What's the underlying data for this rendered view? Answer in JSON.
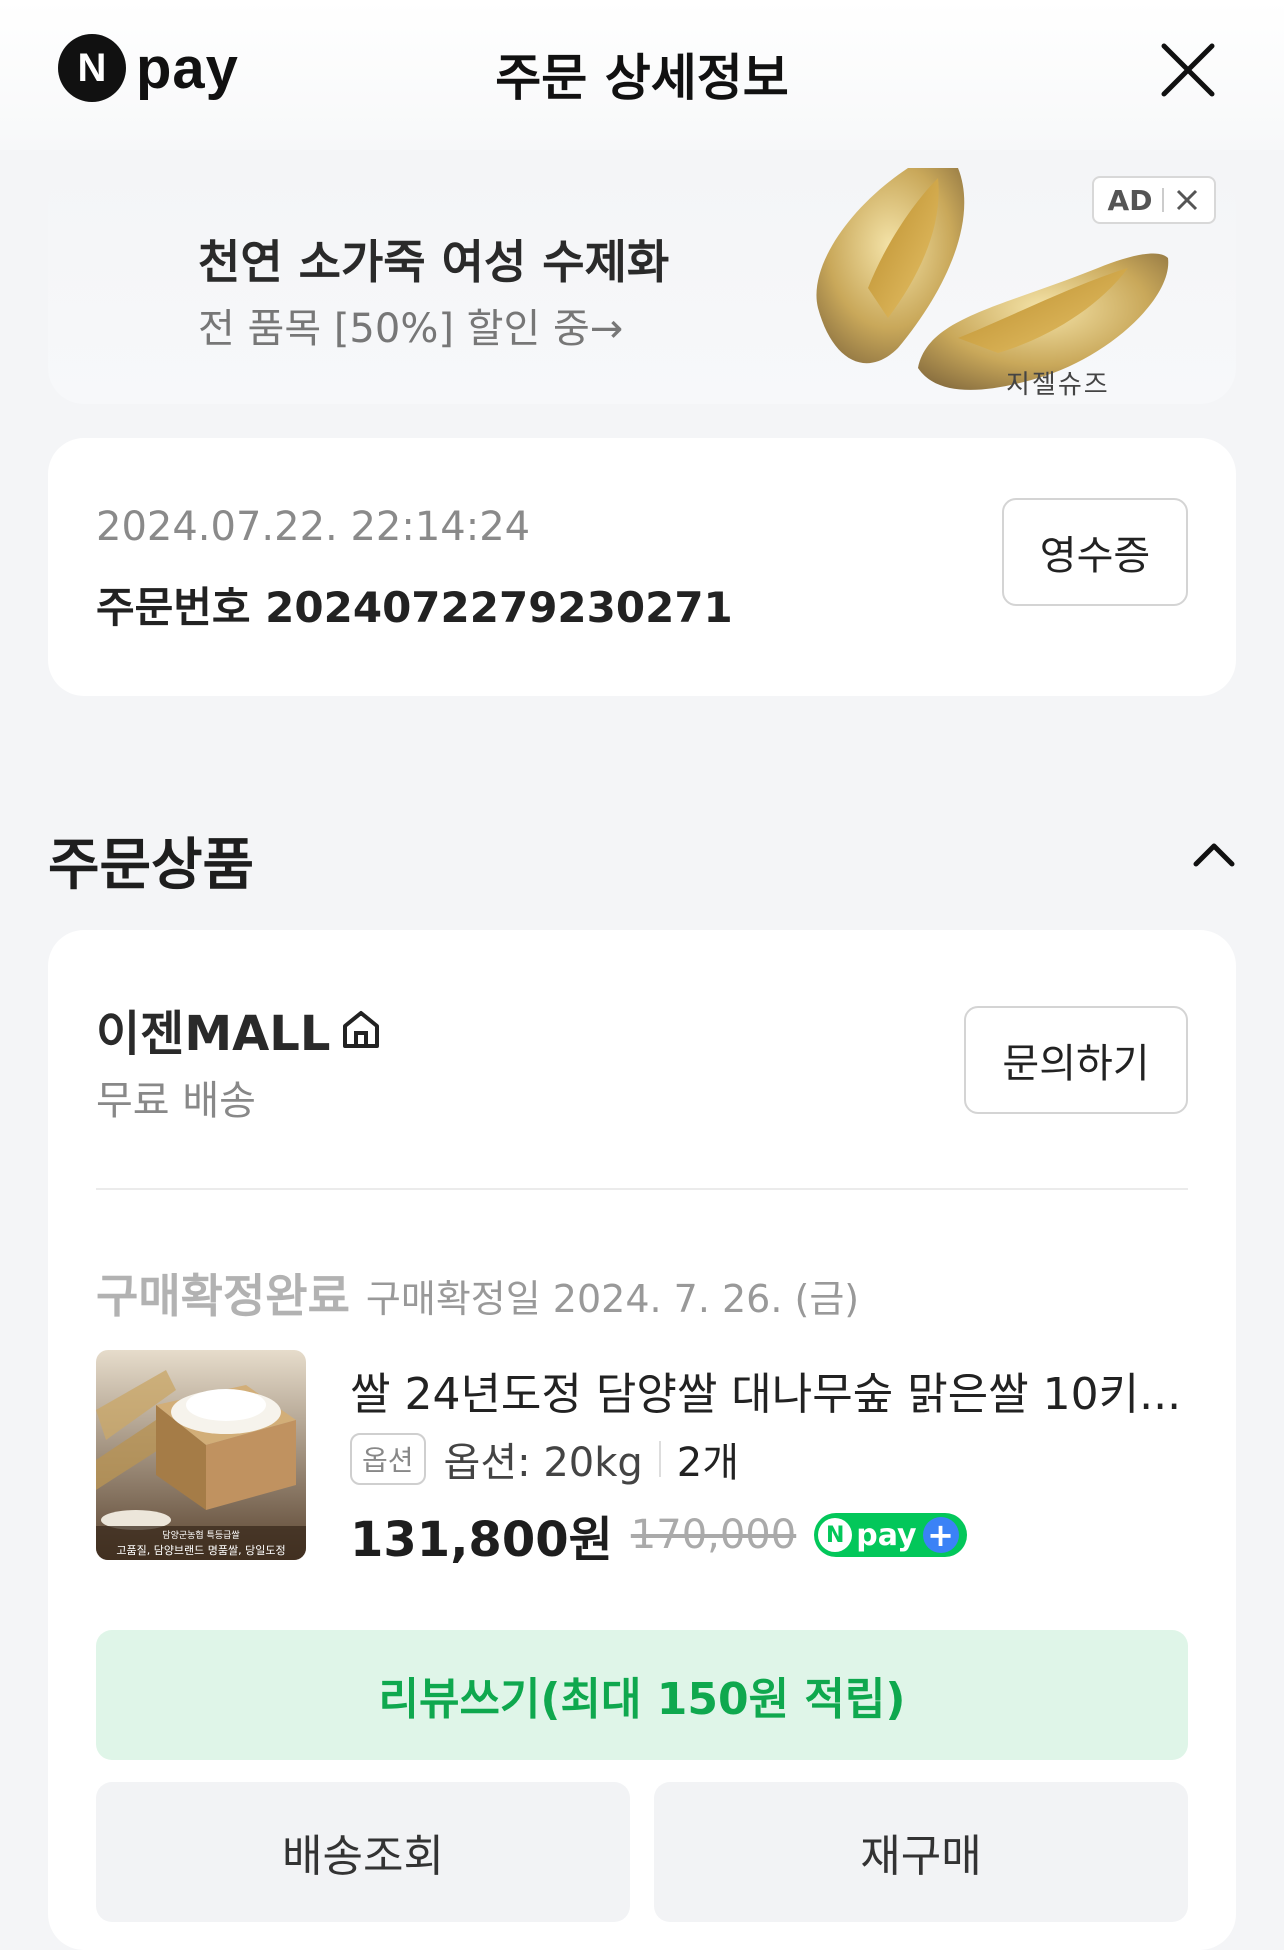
{
  "header": {
    "logo_n": "N",
    "logo_word": "pay",
    "title": "주문 상세정보"
  },
  "ad": {
    "title": "천연 소가죽 여성 수제화",
    "subtitle": "전 품목 [50%] 할인 중→",
    "brand": "지젤슈즈",
    "badge": "AD"
  },
  "order": {
    "datetime": "2024.07.22. 22:14:24",
    "order_number": "주문번호 2024072279230271",
    "receipt_label": "영수증"
  },
  "section": {
    "title": "주문상품"
  },
  "store": {
    "name": "이젠MALL",
    "shipping": "무료 배송",
    "inquiry_label": "문의하기"
  },
  "item": {
    "status": "구매확정완료",
    "status_date": "구매확정일 2024. 7. 26. (금)",
    "name": "쌀 24년도정 담양쌀 대나무숲 맑은쌀 10키...",
    "option_badge": "옵션",
    "option": "옵션: 20kg",
    "quantity": "2개",
    "price": "131,800원",
    "original_price": "170,000",
    "npay_plus_n": "N",
    "npay_plus_word": "pay",
    "npay_plus_sign": "+",
    "thumb_caption_top": "담양군농협 특등급쌀",
    "thumb_caption": "고품질, 담양브랜드 명품쌀, 당일도정"
  },
  "actions": {
    "review": "리뷰쓰기(최대 150원 적립)",
    "tracking": "배송조회",
    "rebuy": "재구매"
  },
  "colors": {
    "npay_green": "#03c75a",
    "review_bg": "#dff5e8",
    "review_text": "#0fa84e"
  }
}
